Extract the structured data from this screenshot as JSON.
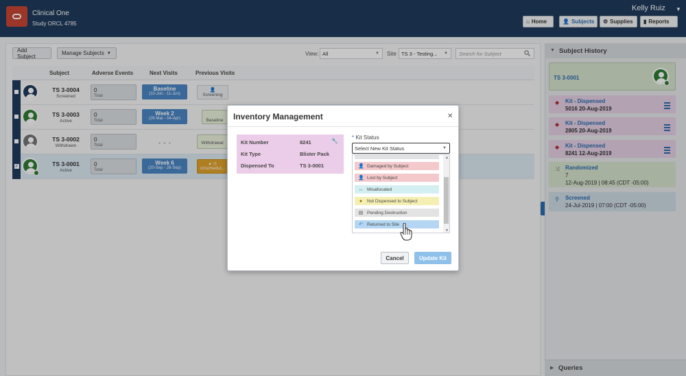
{
  "header": {
    "app_title": "Clinical One",
    "study": "Study ORCL 4785",
    "user": "Kelly Ruiz",
    "nav": [
      {
        "label": "Home",
        "icon": "home-icon"
      },
      {
        "label": "Subjects",
        "icon": "person-icon",
        "active": true
      },
      {
        "label": "Supplies",
        "icon": "supplies-icon"
      },
      {
        "label": "Reports",
        "icon": "bar-chart-icon"
      }
    ]
  },
  "toolbar": {
    "add_subject": "Add Subject",
    "manage_subjects": "Manage Subjects",
    "view_label": "View:",
    "view_value": "All",
    "site_label": "Site",
    "site_value": "TS 3 - Testing...",
    "search_placeholder": "Search for Subject"
  },
  "table": {
    "columns": [
      "Subject",
      "Adverse Events",
      "Next Visits",
      "Previous Visits"
    ],
    "rows": [
      {
        "id": "TS 3-0004",
        "status": "Screened",
        "ae_count": "0",
        "ae_label": "Total",
        "next_visit": "Baseline",
        "next_dates": "(10-Jun - 11-Jun)",
        "prev_visit": "Screening"
      },
      {
        "id": "TS 3-0003",
        "status": "Active",
        "ae_count": "0",
        "ae_label": "Total",
        "next_visit": "Week 2",
        "next_dates": "(29-Mar - 04-Apr)",
        "prev_visit": "Baseline"
      },
      {
        "id": "TS 3-0002",
        "status": "Withdrawn",
        "ae_count": "0",
        "ae_label": "Total",
        "next_visit": "- - -",
        "next_dates": "",
        "prev_visit": "Withdrawal"
      },
      {
        "id": "TS 3-0001",
        "status": "Active",
        "ae_count": "0",
        "ae_label": "Total",
        "next_visit": "Week 6",
        "next_dates": "(20-Sep - 26-Sep)",
        "prev_visit": "Unschedul..."
      }
    ]
  },
  "history": {
    "title": "Subject History",
    "subject": "TS 3-0001",
    "events": [
      {
        "title": "Kit - Dispensed",
        "line1": "5016  20-Aug-2019",
        "line2": ""
      },
      {
        "title": "Kit - Dispensed",
        "line1": "2805  20-Aug-2019",
        "line2": ""
      },
      {
        "title": "Kit - Dispensed",
        "line1": "8241  12-Aug-2019",
        "line2": ""
      },
      {
        "title": "Randomized",
        "line1": "7",
        "line2": "12-Aug-2019 | 08:45 (CDT -05:00)"
      },
      {
        "title": "Screened",
        "line1": "24-Jul-2019 | 07:00 (CDT -05:00)",
        "line2": ""
      }
    ],
    "queries": "Queries"
  },
  "modal": {
    "title": "Inventory Management",
    "kit_number_label": "Kit Number",
    "kit_number": "8241",
    "kit_type_label": "Kit Type",
    "kit_type": "Blister Pack",
    "dispensed_to_label": "Dispensed To",
    "dispensed_to": "TS 3-0001",
    "kit_status_label": "Kit Status",
    "kit_status_placeholder": "Select New Kit Status",
    "options": [
      {
        "label": "Damaged by Subject",
        "icon": "person-icon"
      },
      {
        "label": "Lost by Subject",
        "icon": "person-icon"
      },
      {
        "label": "Misallocated",
        "icon": "arrows-icon"
      },
      {
        "label": "Not Dispensed to Subject",
        "icon": "pill-icon"
      },
      {
        "label": "Pending Destruction",
        "icon": "trash-icon"
      },
      {
        "label": "Returned to Site",
        "icon": "return-icon"
      }
    ],
    "cancel": "Cancel",
    "update": "Update Kit"
  }
}
